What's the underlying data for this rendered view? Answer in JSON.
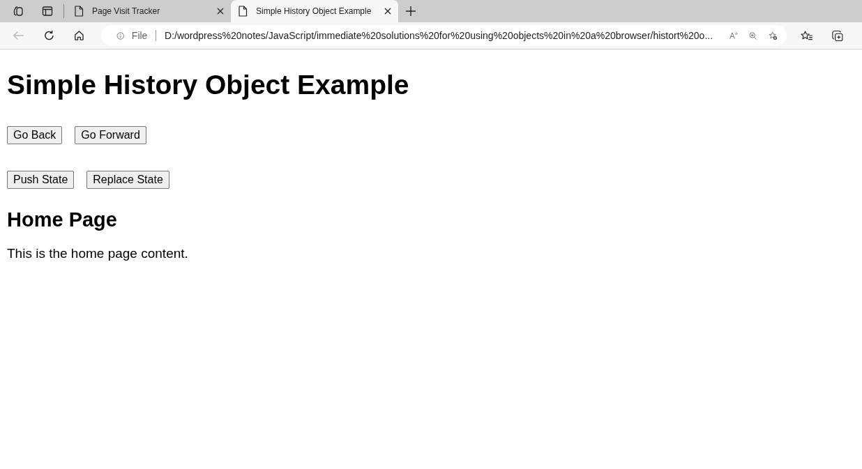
{
  "browser": {
    "tabs": [
      {
        "title": "Page Visit Tracker",
        "selected": false
      },
      {
        "title": "Simple History Object Example",
        "selected": true
      }
    ],
    "address_bar": {
      "scheme_label": "File",
      "url": "D:/wordpress%20notes/JavaScript/immediate%20solutions%20for%20using%20objects%20in%20a%20browser/histort%20o..."
    }
  },
  "page": {
    "heading": "Simple History Object Example",
    "button_rows": [
      [
        "Go Back",
        "Go Forward"
      ],
      [
        "Push State",
        "Replace State"
      ]
    ],
    "section_heading": "Home Page",
    "paragraph": "This is the home page content."
  }
}
